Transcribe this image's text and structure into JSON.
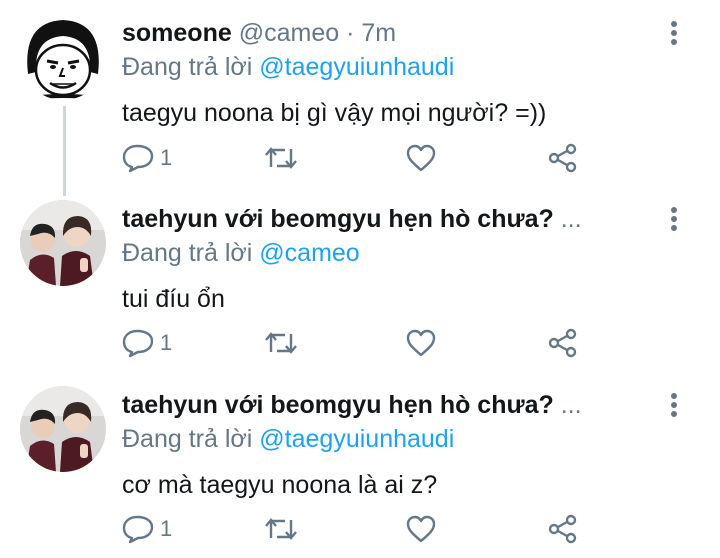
{
  "tweets": [
    {
      "name": "someone",
      "handle": "@cameo",
      "time": "· 7m",
      "ellipsis": "",
      "reply_prefix": "Đang trả lời",
      "reply_to": "@taegyuiunhaudi",
      "text": "taegyu noona bị gì vậy mọi người? =))",
      "reply_count": "1",
      "avatar": "meme-face-avatar"
    },
    {
      "name": "taehyun với beomgyu hẹn hò chưa?",
      "handle": "",
      "time": "",
      "ellipsis": "...",
      "reply_prefix": "Đang trả lời",
      "reply_to": "@cameo",
      "text": "tui đíu ổn",
      "reply_count": "1",
      "avatar": "two-people-photo-avatar"
    },
    {
      "name": "taehyun với beomgyu hẹn hò chưa?",
      "handle": "",
      "time": "",
      "ellipsis": "...",
      "reply_prefix": "Đang trả lời",
      "reply_to": "@taegyuiunhaudi",
      "text": "cơ mà taegyu noona là ai z?",
      "reply_count": "1",
      "avatar": "two-people-photo-avatar"
    }
  ],
  "icons": {
    "reply": "reply-icon",
    "retweet": "retweet-icon",
    "like": "like-icon",
    "share": "share-icon",
    "more": "more-vertical-icon"
  },
  "colors": {
    "link": "#1da1f2",
    "secondary_text": "#657786",
    "primary_text": "#14171a",
    "thread_line": "#ccd6dd"
  }
}
